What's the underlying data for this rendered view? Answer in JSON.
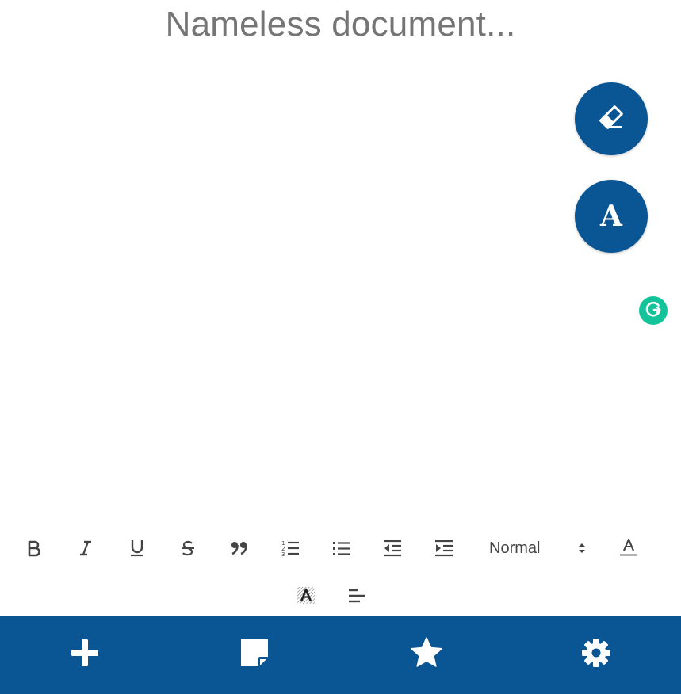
{
  "document": {
    "title_placeholder": "Nameless document..."
  },
  "floating_actions": [
    {
      "name": "eraser",
      "icon": "eraser-icon"
    },
    {
      "name": "font",
      "icon": "font-icon",
      "glyph": "A"
    }
  ],
  "grammarly": {
    "icon": "grammarly-icon",
    "color": "#15c39a"
  },
  "toolbar": {
    "row1": [
      {
        "icon": "bold-icon"
      },
      {
        "icon": "italic-icon"
      },
      {
        "icon": "underline-icon"
      },
      {
        "icon": "strikethrough-icon"
      },
      {
        "icon": "blockquote-icon"
      },
      {
        "icon": "ordered-list-icon"
      },
      {
        "icon": "bullet-list-icon"
      },
      {
        "icon": "outdent-icon"
      },
      {
        "icon": "indent-icon"
      }
    ],
    "header_select": {
      "selected": "Normal"
    },
    "row2": [
      {
        "icon": "text-color-icon"
      },
      {
        "icon": "background-color-icon",
        "glyph": "A"
      },
      {
        "icon": "align-left-icon"
      }
    ]
  },
  "bottom_nav": [
    {
      "icon": "plus-icon"
    },
    {
      "icon": "note-icon"
    },
    {
      "icon": "star-icon"
    },
    {
      "icon": "gear-icon"
    }
  ],
  "colors": {
    "primary": "#0a5593",
    "toolbar_icon": "#444444",
    "title_text": "#757575"
  }
}
